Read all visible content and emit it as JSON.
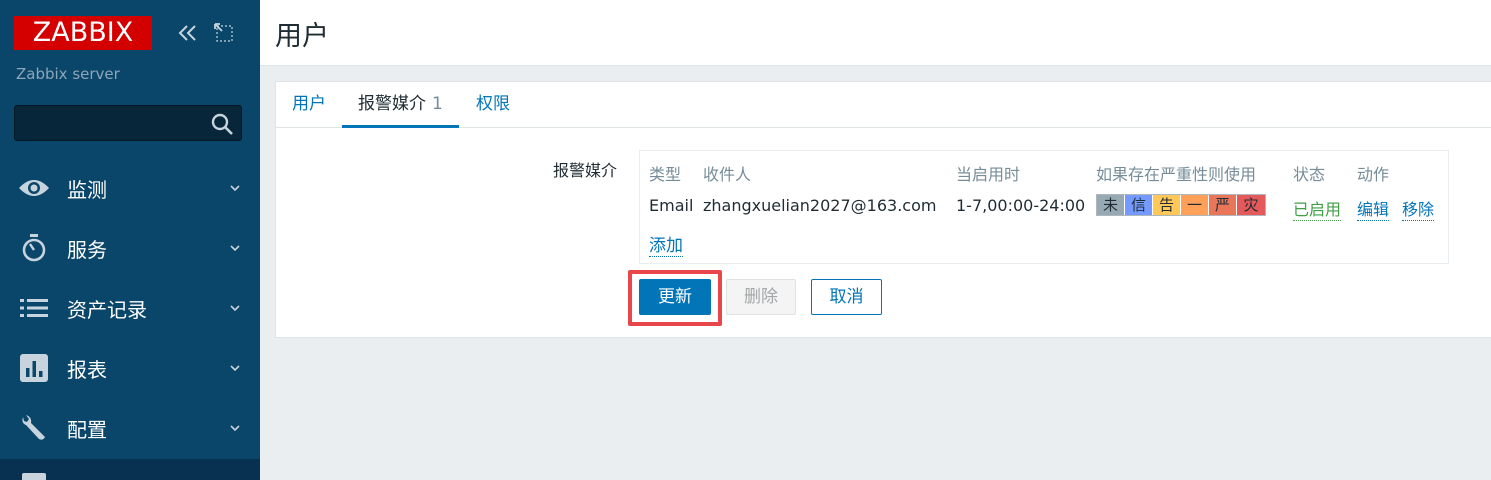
{
  "sidebar": {
    "logo": "ZABBIX",
    "server_name": "Zabbix server",
    "search_placeholder": "",
    "items": [
      {
        "label": "监测",
        "icon": "eye-icon"
      },
      {
        "label": "服务",
        "icon": "stopwatch-icon"
      },
      {
        "label": "资产记录",
        "icon": "list-icon"
      },
      {
        "label": "报表",
        "icon": "bar-chart-icon"
      },
      {
        "label": "配置",
        "icon": "wrench-icon"
      }
    ]
  },
  "header": {
    "title": "用户"
  },
  "tabs": [
    {
      "label": "用户",
      "count": ""
    },
    {
      "label": "报警媒介",
      "count": "1"
    },
    {
      "label": "权限",
      "count": ""
    }
  ],
  "form": {
    "media_label": "报警媒介",
    "columns": [
      "类型",
      "收件人",
      "当启用时",
      "如果存在严重性则使用",
      "状态",
      "动作"
    ],
    "row": {
      "type": "Email",
      "recipient": "zhangxuelian2027@163.com",
      "when_active": "1-7,00:00-24:00",
      "severities": [
        {
          "label": "未",
          "color": "#97aab3"
        },
        {
          "label": "信",
          "color": "#7499ff"
        },
        {
          "label": "告",
          "color": "#ffc859"
        },
        {
          "label": "一",
          "color": "#ffa059"
        },
        {
          "label": "严",
          "color": "#e97659"
        },
        {
          "label": "灾",
          "color": "#e45959"
        }
      ],
      "status": "已启用",
      "edit": "编辑",
      "remove": "移除"
    },
    "add": "添加"
  },
  "buttons": {
    "update": "更新",
    "delete": "删除",
    "cancel": "取消"
  },
  "colors": {
    "sidebar_bg": "#0a466a",
    "accent": "#0275b8",
    "logo_bg": "#d40000",
    "highlight": "#e8464a"
  }
}
